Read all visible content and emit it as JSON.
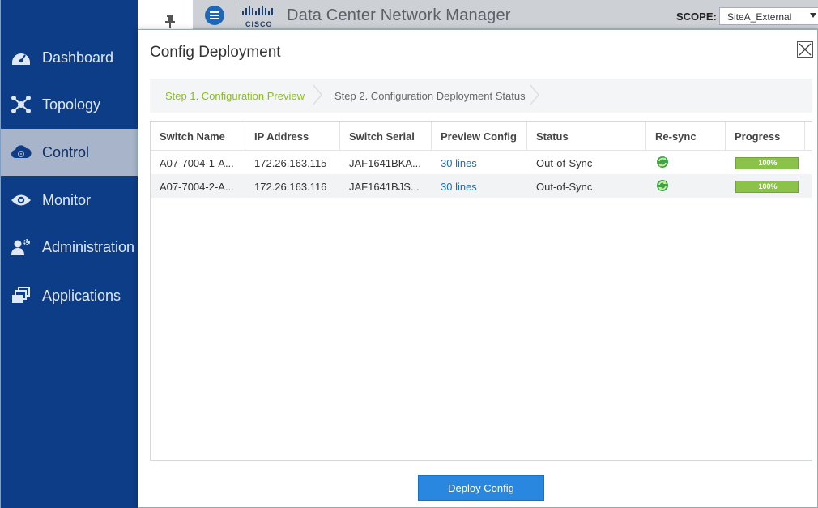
{
  "sidebar": {
    "items": [
      {
        "label": "Dashboard",
        "icon": "dashboard-icon"
      },
      {
        "label": "Topology",
        "icon": "topology-icon"
      },
      {
        "label": "Control",
        "icon": "control-icon",
        "active": true
      },
      {
        "label": "Monitor",
        "icon": "eye-icon"
      },
      {
        "label": "Administration",
        "icon": "admin-user-icon"
      },
      {
        "label": "Applications",
        "icon": "applications-icon"
      }
    ]
  },
  "header": {
    "logo_text": "CISCO",
    "title": "Data Center Network Manager",
    "scope_label": "SCOPE:",
    "scope_value": "SiteA_External"
  },
  "modal": {
    "title": "Config Deployment",
    "steps": [
      {
        "label": "Step 1. Configuration Preview",
        "active": true
      },
      {
        "label": "Step 2. Configuration Deployment Status",
        "active": false
      }
    ],
    "table": {
      "columns": [
        "Switch Name",
        "IP Address",
        "Switch Serial",
        "Preview Config",
        "Status",
        "Re-sync",
        "Progress"
      ],
      "rows": [
        {
          "switch_name": "A07-7004-1-A...",
          "ip": "172.26.163.115",
          "serial": "JAF1641BKA...",
          "preview": "30 lines",
          "status": "Out-of-Sync",
          "progress": 100,
          "progress_label": "100%"
        },
        {
          "switch_name": "A07-7004-2-A...",
          "ip": "172.26.163.116",
          "serial": "JAF1641BJS...",
          "preview": "30 lines",
          "status": "Out-of-Sync",
          "progress": 100,
          "progress_label": "100%"
        }
      ]
    },
    "deploy_label": "Deploy Config"
  },
  "colors": {
    "sidebar_bg": "#0d3d87",
    "active_step": "#8dbb26",
    "link": "#1e6fb8",
    "progress": "#8bc34a",
    "button": "#2a87e0"
  }
}
